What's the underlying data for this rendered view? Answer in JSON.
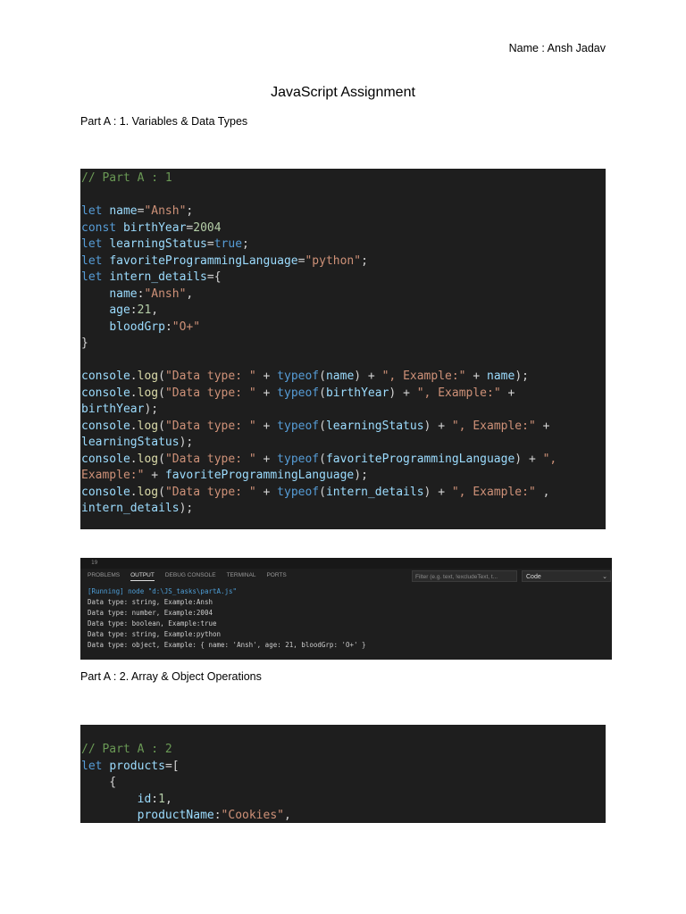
{
  "header": {
    "author": "Name : Ansh Jadav",
    "title": "JavaScript Assignment"
  },
  "sections": {
    "part_a1": "Part A : 1. Variables & Data Types",
    "part_a2": "Part A : 2.  Array & Object Operations"
  },
  "code1": {
    "comment": "// Part A : 1",
    "kw_let": "let",
    "kw_const": "const",
    "v_name": "name",
    "s_ansh": "\"Ansh\"",
    "v_birthYear": "birthYear",
    "n_2004": "2004",
    "v_learningStatus": "learningStatus",
    "b_true": "true",
    "v_fpl": "favoriteProgrammingLanguage",
    "s_python": "\"python\"",
    "v_intern": "intern_details",
    "p_age": "age",
    "n_21": "21",
    "p_blood": "bloodGrp",
    "s_blood": "\"O+\"",
    "console": "console",
    "log": "log",
    "typeof": "typeof",
    "s_datatype": "\"Data type: \"",
    "s_example": "\", Example:\"",
    "s_example_a": "\",",
    "s_example_b": "Example:\""
  },
  "terminal": {
    "line_label": "19",
    "tabs": [
      "PROBLEMS",
      "OUTPUT",
      "DEBUG CONSOLE",
      "TERMINAL",
      "PORTS"
    ],
    "filter_placeholder": "Filter (e.g. text, !excludeText, t...",
    "select_value": "Code",
    "output": [
      "[Running] node \"d:\\JS_tasks\\partA.js\"",
      "Data type: string, Example:Ansh",
      "Data type: number, Example:2004",
      "Data type: boolean, Example:true",
      "Data type: string, Example:python",
      "Data type: object, Example: { name: 'Ansh', age: 21, bloodGrp: 'O+' }"
    ]
  },
  "code2": {
    "comment": "// Part A : 2",
    "kw_let": "let",
    "v_products": "products",
    "p_id": "id",
    "n_1": "1",
    "p_productName": "productName",
    "s_cookies": "\"Cookies\""
  },
  "colors": {
    "code_bg": "#1e1e1e",
    "keyword": "#569cd6",
    "variable": "#9cdcfe",
    "string": "#ce9178",
    "number": "#b5cea8",
    "comment": "#6a9955"
  }
}
